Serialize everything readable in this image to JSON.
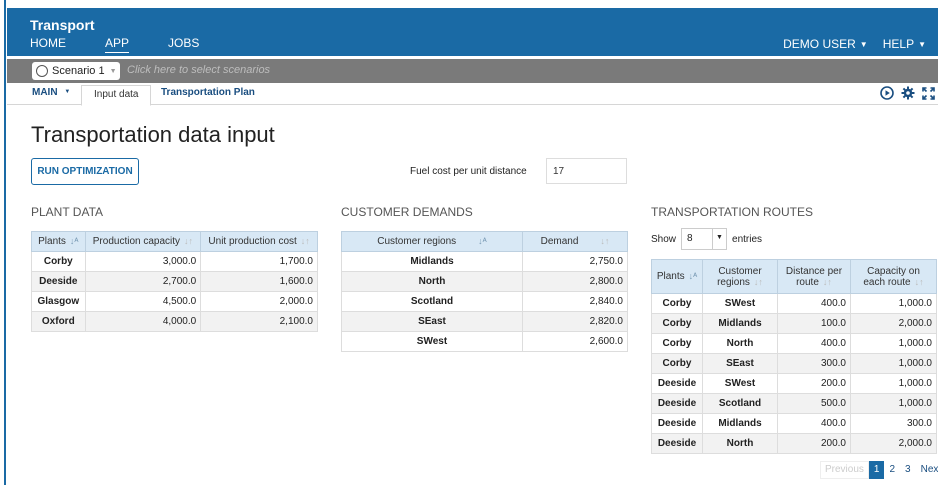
{
  "app": {
    "title": "Transport"
  },
  "nav": {
    "home": "HOME",
    "app": "APP",
    "jobs": "JOBS",
    "user": "DEMO USER",
    "help": "HELP"
  },
  "scenario": {
    "name": "Scenario 1",
    "hint": "Click here to select scenarios"
  },
  "tabs": {
    "main": "MAIN",
    "input": "Input data",
    "plan": "Transportation Plan"
  },
  "icons": {
    "run": "play-circle-icon",
    "settings": "gear-icon",
    "fullscreen": "expand-icon"
  },
  "page": {
    "title": "Transportation data input",
    "run_button": "RUN OPTIMIZATION",
    "fuel_label": "Fuel cost per unit distance",
    "fuel_value": "17"
  },
  "plant": {
    "title": "PLANT DATA",
    "headers": [
      "Plants",
      "Production capacity",
      "Unit production cost"
    ],
    "rows": [
      [
        "Corby",
        "3,000.0",
        "1,700.0"
      ],
      [
        "Deeside",
        "2,700.0",
        "1,600.0"
      ],
      [
        "Glasgow",
        "4,500.0",
        "2,000.0"
      ],
      [
        "Oxford",
        "4,000.0",
        "2,100.0"
      ]
    ]
  },
  "customer": {
    "title": "CUSTOMER DEMANDS",
    "headers": [
      "Customer regions",
      "Demand"
    ],
    "rows": [
      [
        "Midlands",
        "2,750.0"
      ],
      [
        "North",
        "2,800.0"
      ],
      [
        "Scotland",
        "2,840.0"
      ],
      [
        "SEast",
        "2,820.0"
      ],
      [
        "SWest",
        "2,600.0"
      ]
    ]
  },
  "routes": {
    "title": "TRANSPORTATION ROUTES",
    "show_label": "Show",
    "show_value": "8",
    "entries_label": "entries",
    "headers": [
      "Plants",
      "Customer regions",
      "Distance per route",
      "Capacity on each route"
    ],
    "rows": [
      [
        "Corby",
        "SWest",
        "400.0",
        "1,000.0"
      ],
      [
        "Corby",
        "Midlands",
        "100.0",
        "2,000.0"
      ],
      [
        "Corby",
        "North",
        "400.0",
        "1,000.0"
      ],
      [
        "Corby",
        "SEast",
        "300.0",
        "1,000.0"
      ],
      [
        "Deeside",
        "SWest",
        "200.0",
        "1,000.0"
      ],
      [
        "Deeside",
        "Scotland",
        "500.0",
        "1,000.0"
      ],
      [
        "Deeside",
        "Midlands",
        "400.0",
        "300.0"
      ],
      [
        "Deeside",
        "North",
        "200.0",
        "2,000.0"
      ]
    ],
    "pager": {
      "previous": "Previous",
      "pages": [
        "1",
        "2",
        "3"
      ],
      "next": "Next"
    }
  }
}
